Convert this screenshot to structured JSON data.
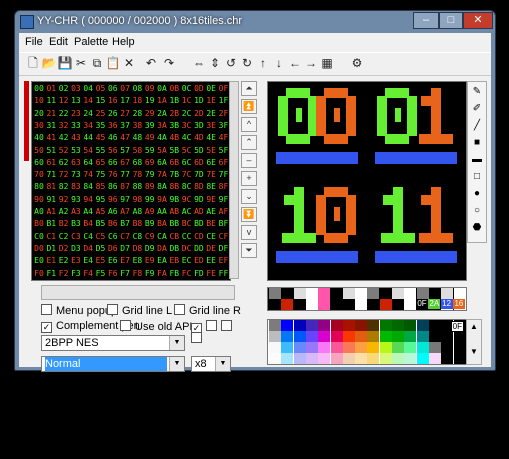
{
  "window": {
    "title": "YY-CHR ( 000000 / 002000 )  8x16tiles.chr",
    "minimize_glyph": "–",
    "maximize_glyph": "□",
    "close_glyph": "✕"
  },
  "menu": [
    "File",
    "Edit",
    "Palette",
    "Help"
  ],
  "toolbar_icons": [
    "new-file-icon",
    "open-folder-icon",
    "save-icon",
    "cut-icon",
    "copy-icon",
    "paste-icon",
    "clear-icon",
    "undo-icon",
    "redo-icon",
    "flip-horizontal-icon",
    "flip-vertical-icon",
    "rotate-left-icon",
    "rotate-right-icon",
    "shift-up-icon",
    "shift-down-icon",
    "shift-left-icon",
    "shift-right-icon",
    "palette-icon",
    "settings-icon"
  ],
  "toolbar_glyphs": [
    "🗋",
    "📂",
    "💾",
    "✂",
    "⧉",
    "📋",
    "✕",
    "↶",
    "↷",
    "⇔",
    "⇕",
    "↺",
    "↻",
    "↑",
    "↓",
    "←",
    "→",
    "▦",
    "⚙"
  ],
  "tile_grid": {
    "rows": 16,
    "cols": 16,
    "first_byte": 0,
    "labels": [
      "00",
      "01",
      "02",
      "03",
      "04",
      "05",
      "06",
      "07",
      "08",
      "09",
      "0A",
      "0B",
      "0C",
      "0D",
      "0E",
      "0F",
      "10",
      "11",
      "12",
      "13",
      "14",
      "15",
      "16",
      "17",
      "18",
      "19",
      "1A",
      "1B",
      "1C",
      "1D",
      "1E",
      "1F",
      "20",
      "21",
      "22",
      "23",
      "24",
      "25",
      "26",
      "27",
      "28",
      "29",
      "2A",
      "2B",
      "2C",
      "2D",
      "2E",
      "2F",
      "30",
      "31",
      "32",
      "33",
      "34",
      "35",
      "36",
      "37",
      "38",
      "39",
      "3A",
      "3B",
      "3C",
      "3D",
      "3E",
      "3F",
      "40",
      "41",
      "42",
      "43",
      "44",
      "45",
      "46",
      "47",
      "48",
      "49",
      "4A",
      "4B",
      "4C",
      "4D",
      "4E",
      "4F",
      "50",
      "51",
      "52",
      "53",
      "54",
      "55",
      "56",
      "57",
      "58",
      "59",
      "5A",
      "5B",
      "5C",
      "5D",
      "5E",
      "5F",
      "60",
      "61",
      "62",
      "63",
      "64",
      "65",
      "66",
      "67",
      "68",
      "69",
      "6A",
      "6B",
      "6C",
      "6D",
      "6E",
      "6F",
      "70",
      "71",
      "72",
      "73",
      "74",
      "75",
      "76",
      "77",
      "78",
      "79",
      "7A",
      "7B",
      "7C",
      "7D",
      "7E",
      "7F",
      "80",
      "81",
      "82",
      "83",
      "84",
      "85",
      "86",
      "87",
      "88",
      "89",
      "8A",
      "8B",
      "8C",
      "8D",
      "8E",
      "8F",
      "90",
      "91",
      "92",
      "93",
      "94",
      "95",
      "96",
      "97",
      "98",
      "99",
      "9A",
      "9B",
      "9C",
      "9D",
      "9E",
      "9F",
      "A0",
      "A1",
      "A2",
      "A3",
      "A4",
      "A5",
      "A6",
      "A7",
      "A8",
      "A9",
      "AA",
      "AB",
      "AC",
      "AD",
      "AE",
      "AF",
      "B0",
      "B1",
      "B2",
      "B3",
      "B4",
      "B5",
      "B6",
      "B7",
      "B8",
      "B9",
      "BA",
      "BB",
      "BC",
      "BD",
      "BE",
      "BF",
      "C0",
      "C1",
      "C2",
      "C3",
      "C4",
      "C5",
      "C6",
      "C7",
      "C8",
      "C9",
      "CA",
      "CB",
      "CC",
      "CD",
      "CE",
      "CF",
      "D0",
      "D1",
      "D2",
      "D3",
      "D4",
      "D5",
      "D6",
      "D7",
      "D8",
      "D9",
      "DA",
      "DB",
      "DC",
      "DD",
      "DE",
      "DF",
      "E0",
      "E1",
      "E2",
      "E3",
      "E4",
      "E5",
      "E6",
      "E7",
      "E8",
      "E9",
      "EA",
      "EB",
      "EC",
      "ED",
      "EE",
      "EF",
      "F0",
      "F1",
      "F2",
      "F3",
      "F4",
      "F5",
      "F6",
      "F7",
      "F8",
      "F9",
      "FA",
      "FB",
      "FC",
      "FD",
      "FE",
      "FF"
    ]
  },
  "nav_glyphs": [
    "⏶",
    "⏫",
    "^",
    "⌃",
    "–",
    "+",
    "⌄",
    "⏬",
    "v",
    "⏷"
  ],
  "editor": {
    "tiles": [
      {
        "digit1": "0",
        "digit2": "0"
      },
      {
        "digit1": "0",
        "digit2": "1"
      },
      {
        "digit1": "1",
        "digit2": "0"
      },
      {
        "digit1": "1",
        "digit2": "1"
      }
    ],
    "colors": {
      "green": "#66ee33",
      "orange": "#e8641a",
      "blue": "#3355ee",
      "background": "#000000"
    }
  },
  "draw_tools": [
    "pen-icon",
    "pencil-icon",
    "line-icon",
    "rect-fill-icon",
    "rect-fill-gray-icon",
    "rect-outline-icon",
    "circle-fill-icon",
    "circle-outline-icon",
    "fill-bucket-icon"
  ],
  "draw_glyphs": [
    "✎",
    "✐",
    "╱",
    "■",
    "▬",
    "□",
    "●",
    "○",
    "⬣"
  ],
  "options": {
    "menu_popup": {
      "label": "Menu popup",
      "checked": false
    },
    "grid_line_l": {
      "label": "Grid line L",
      "checked": false
    },
    "grid_line_r": {
      "label": "Grid line R",
      "checked": false
    },
    "complement_pen": {
      "label": "Complement pen",
      "checked": true
    },
    "use_old_api": {
      "label": "Use old API",
      "checked": false
    }
  },
  "format_select": {
    "value": "2BPP NES"
  },
  "mode_select": {
    "value": "Normal"
  },
  "zoom_select": {
    "value": "x8"
  },
  "palette_strip": {
    "colors": [
      "#7c7c7c",
      "#000000",
      "#dddddd",
      "#ffffff",
      "#ff55aa",
      "#000000",
      "#dddddd",
      "#ffffff",
      "#7c7c7c",
      "#000000",
      "#dddddd",
      "#ffffff",
      "#7c7c7c",
      "#000000",
      "#dddddd",
      "#ffffff"
    ],
    "lower": [
      "#000000",
      "#cc2200",
      "#000000",
      "#ffffff",
      "#ff55aa",
      "#000000",
      "#000000",
      "#ffffff",
      "#000000",
      "#cc2200",
      "#000000",
      "#ffffff",
      "#000000",
      "#000000",
      "#ffffff",
      "#ffffff"
    ],
    "labels": [
      {
        "text": "0F",
        "color": "#000000"
      },
      {
        "text": "2A",
        "color": "#55cc33"
      },
      {
        "text": "12",
        "color": "#3355ee"
      },
      {
        "text": "16",
        "color": "#e8641a"
      }
    ]
  },
  "full_palette": {
    "rows": [
      [
        "#7c7c7c",
        "#0000fc",
        "#0000bc",
        "#4428bc",
        "#940084",
        "#a80020",
        "#a81000",
        "#881400",
        "#503000",
        "#007800",
        "#006800",
        "#005800",
        "#004058",
        "#000000",
        "#000000",
        "#000000"
      ],
      [
        "#bcbcbc",
        "#0078f8",
        "#0058f8",
        "#6844fc",
        "#d800cc",
        "#e40058",
        "#f83800",
        "#e45c10",
        "#ac7c00",
        "#00b800",
        "#00a800",
        "#00a844",
        "#008888",
        "#000000",
        "#000000",
        "#000000"
      ],
      [
        "#f8f8f8",
        "#3cbcfc",
        "#6888fc",
        "#9878f8",
        "#f878f8",
        "#f85898",
        "#f87858",
        "#fca044",
        "#f8b800",
        "#b8f818",
        "#58d854",
        "#58f898",
        "#00e8d8",
        "#787878",
        "#000000",
        "#000000"
      ],
      [
        "#fcfcfc",
        "#a4e4fc",
        "#b8b8f8",
        "#d8b8f8",
        "#f8b8f8",
        "#f8a4c0",
        "#f0d0b0",
        "#fce0a8",
        "#f8d878",
        "#d8f878",
        "#b8f8b8",
        "#b8f8d8",
        "#00fcfc",
        "#f8d8f8",
        "#000000",
        "#000000"
      ]
    ],
    "selected_label": "0F"
  }
}
